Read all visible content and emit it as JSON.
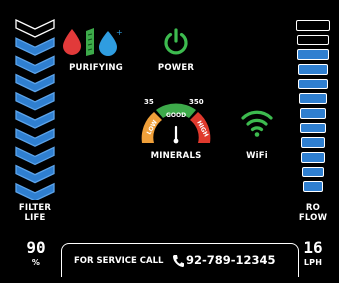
{
  "colors": {
    "accent_blue": "#2f7fd0",
    "drop_red": "#e23a3a",
    "leaf_green": "#3daa4a",
    "power_green": "#3dbb4f",
    "wifi_green": "#3dbb4f",
    "gauge_low": "#f0a03a",
    "gauge_good": "#3daa4a",
    "gauge_high": "#e0392d"
  },
  "filter_life": {
    "label_line1": "FILTER",
    "label_line2": "LIFE",
    "value": "90",
    "unit": "%",
    "segments_total": 10,
    "segments_lit": 9
  },
  "ro_flow": {
    "label_line1": "RO",
    "label_line2": "FLOW",
    "value": "16",
    "unit": "LPH",
    "segments_total": 12,
    "segments_lit": 10
  },
  "status": {
    "purifying_label": "PURIFYING",
    "power_label": "POWER",
    "minerals_label": "MINERALS",
    "wifi_label": "WiFi"
  },
  "gauge": {
    "min_label": "35",
    "max_label": "350",
    "low_label": "LOW",
    "good_label": "GOOD",
    "high_label": "HIGH"
  },
  "service": {
    "label": "FOR SERVICE CALL",
    "phone": "92-789-12345"
  },
  "icons": {
    "purifying": "drops-leaf-icon",
    "power": "power-icon",
    "minerals": "gauge-icon",
    "wifi": "wifi-icon",
    "phone": "phone-icon"
  }
}
